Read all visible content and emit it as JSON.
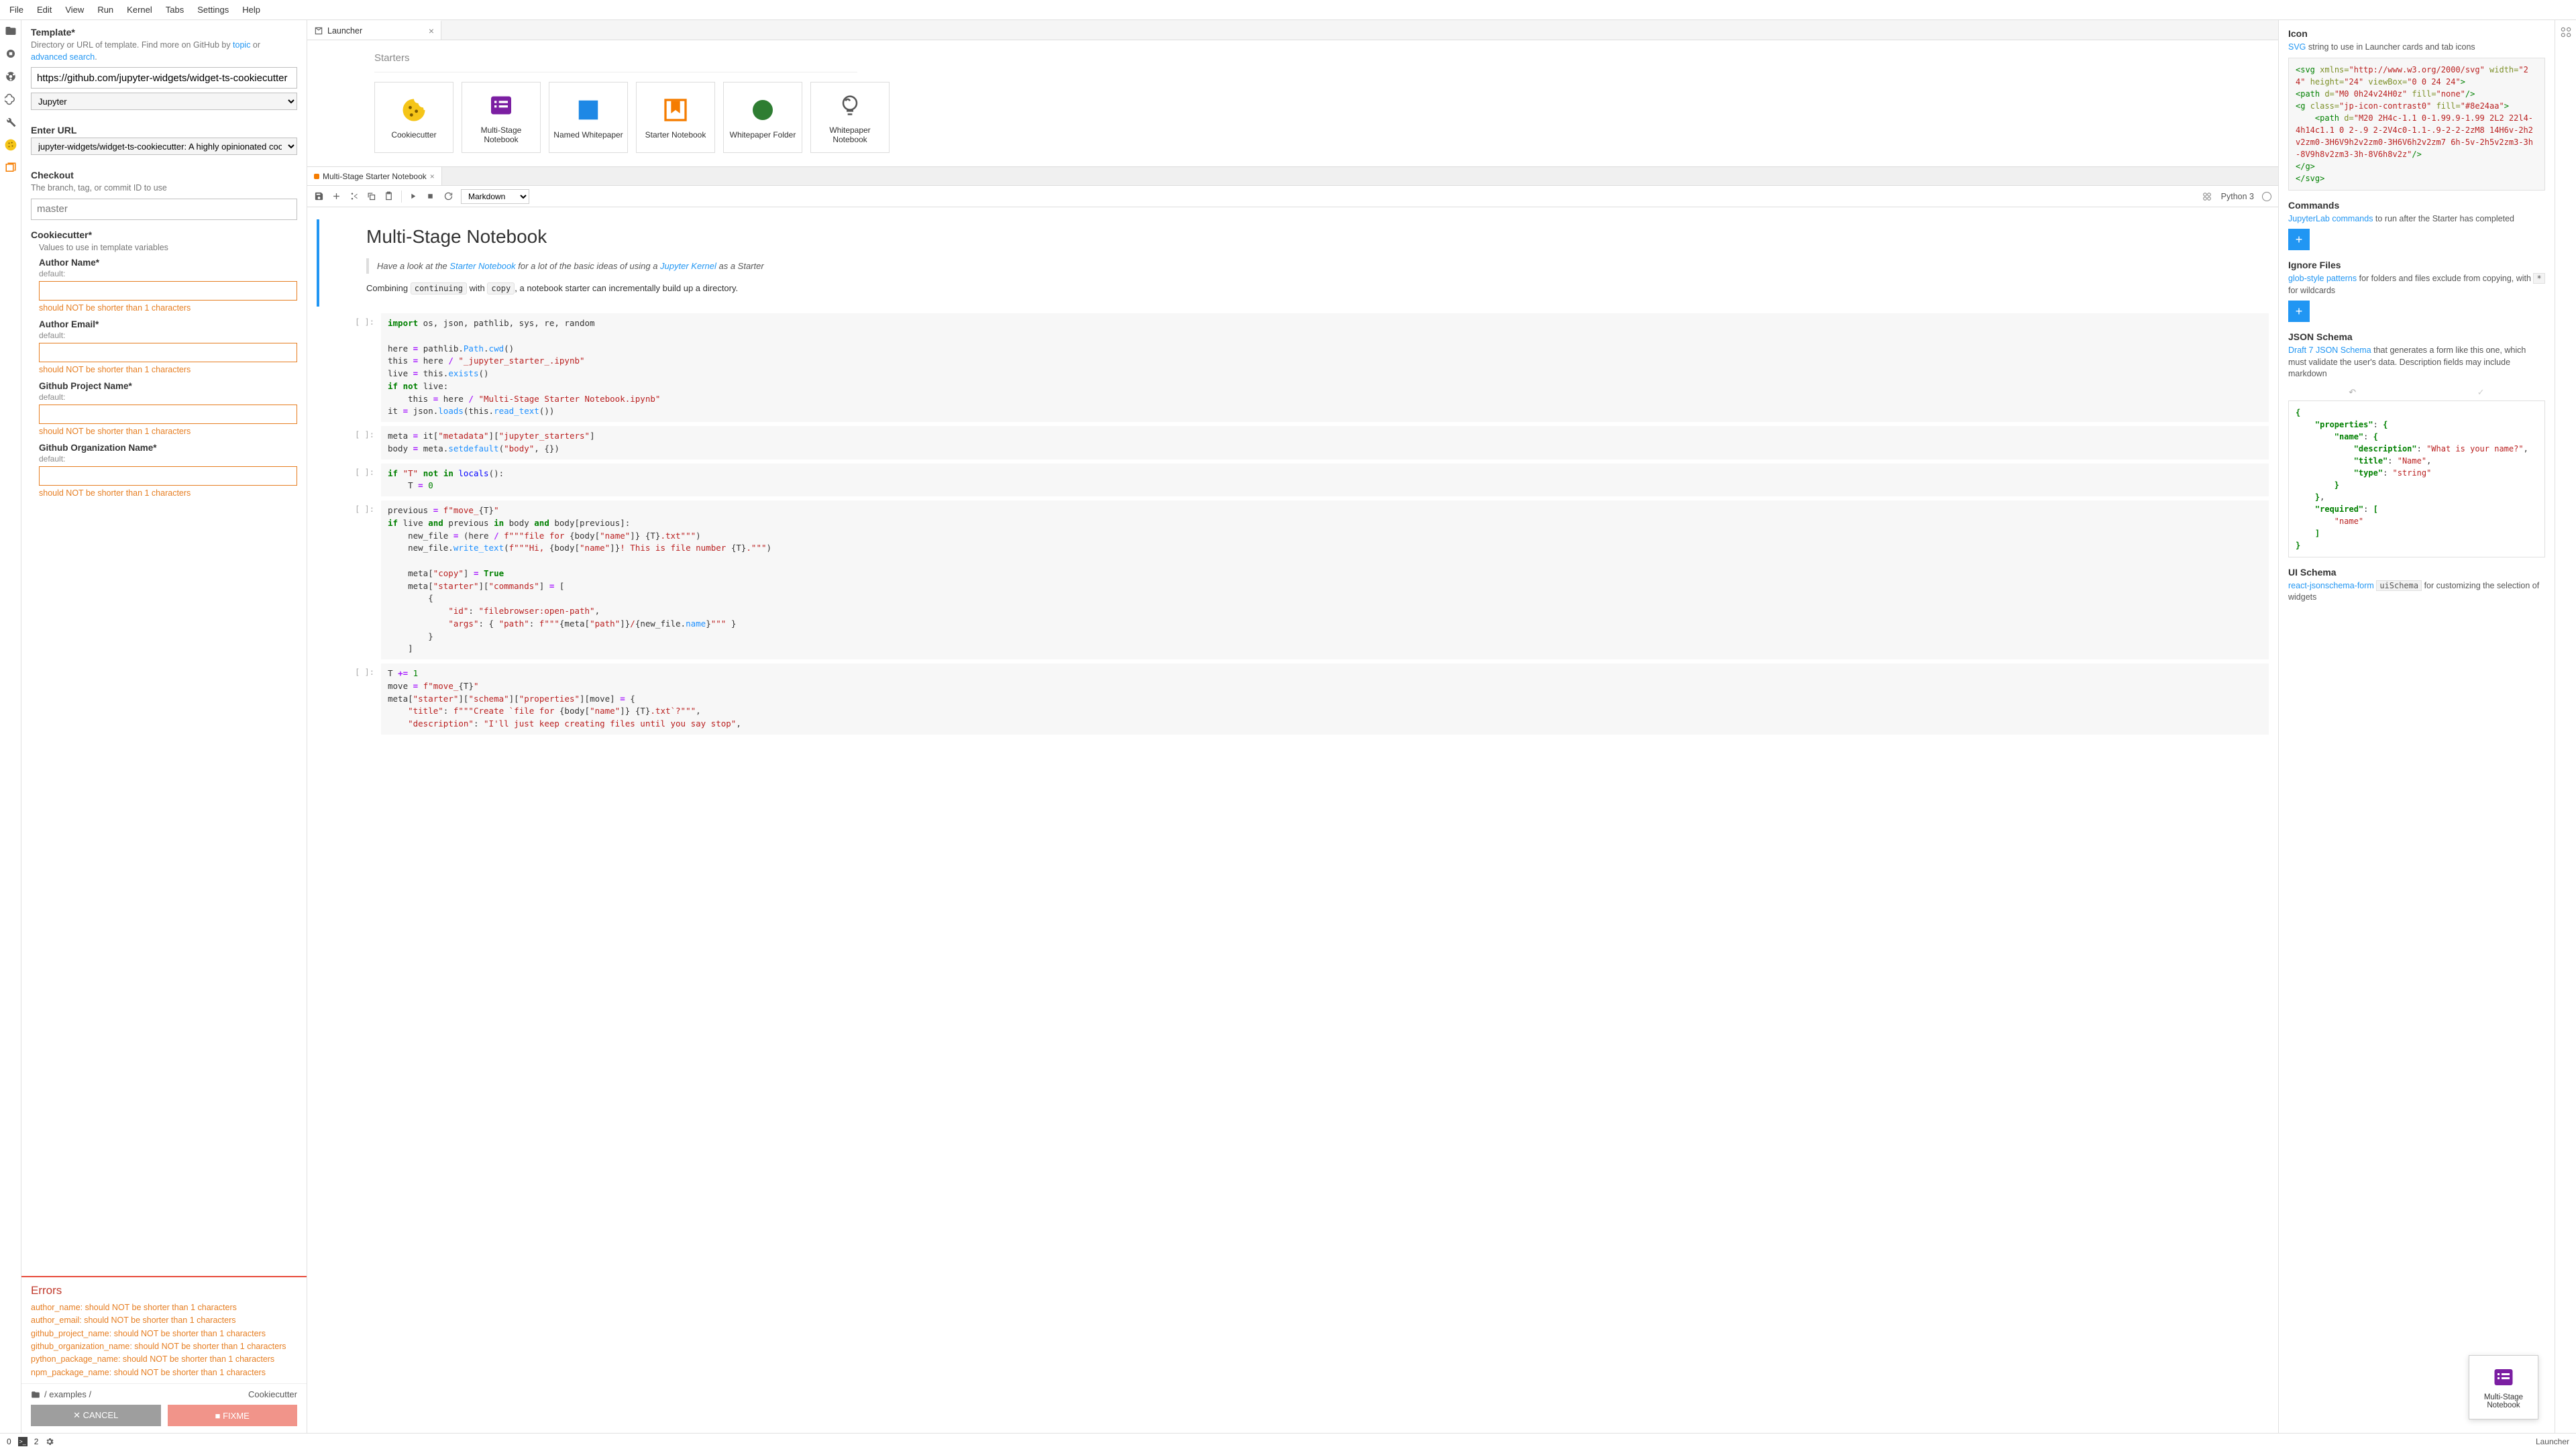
{
  "menu": [
    "File",
    "Edit",
    "View",
    "Run",
    "Kernel",
    "Tabs",
    "Settings",
    "Help"
  ],
  "left_panel": {
    "template_title": "Template*",
    "template_desc_prefix": "Directory or URL of template. Find more on GitHub by ",
    "template_link1": "topic",
    "template_desc_or": " or ",
    "template_link2": "advanced search",
    "template_value": "https://github.com/jupyter-widgets/widget-ts-cookiecutter",
    "template_select": "Jupyter",
    "enter_url_title": "Enter URL",
    "enter_url_value": "jupyter-widgets/widget-ts-cookiecutter: A highly opinionated cookiecutter template",
    "checkout_title": "Checkout",
    "checkout_desc": "The branch, tag, or commit ID to use",
    "checkout_placeholder": "master",
    "cookiecutter_title": "Cookiecutter*",
    "cookiecutter_desc": "Values to use in template variables",
    "fields": [
      {
        "label": "Author Name*",
        "sub": "default:",
        "error": "should NOT be shorter than 1 characters"
      },
      {
        "label": "Author Email*",
        "sub": "default:",
        "error": "should NOT be shorter than 1 characters"
      },
      {
        "label": "Github Project Name*",
        "sub": "default:",
        "error": "should NOT be shorter than 1 characters"
      },
      {
        "label": "Github Organization Name*",
        "sub": "default:",
        "error": "should NOT be shorter than 1 characters"
      }
    ],
    "errors_title": "Errors",
    "errors": [
      "author_name: should NOT be shorter than 1 characters",
      "author_email: should NOT be shorter than 1 characters",
      "github_project_name: should NOT be shorter than 1 characters",
      "github_organization_name: should NOT be shorter than 1 characters",
      "python_package_name: should NOT be shorter than 1 characters",
      "npm_package_name: should NOT be shorter than 1 characters"
    ],
    "breadcrumb": "/ examples /",
    "breadcrumb_right": "Cookiecutter",
    "cancel": "CANCEL",
    "fixme": "FIXME"
  },
  "launcher": {
    "tab": "Launcher",
    "heading": "Starters",
    "cards": [
      {
        "label": "Cookiecutter",
        "icon": "cookie"
      },
      {
        "label": "Multi-Stage Notebook",
        "icon": "list"
      },
      {
        "label": "Named Whitepaper",
        "icon": "square"
      },
      {
        "label": "Starter Notebook",
        "icon": "bookmark"
      },
      {
        "label": "Whitepaper Folder",
        "icon": "circle"
      },
      {
        "label": "Whitepaper Notebook",
        "icon": "bulb"
      }
    ]
  },
  "notebook": {
    "tab": "Multi-Stage Starter Notebook",
    "celltype": "Markdown",
    "kernel": "Python 3",
    "md": {
      "title": "Multi-Stage Notebook",
      "quote_pre": "Have a look at the ",
      "quote_link1": "Starter Notebook",
      "quote_mid": " for a lot of the basic ideas of using a ",
      "quote_link2": "Jupyter Kernel",
      "quote_post": " as a Starter",
      "para_pre": "Combining ",
      "para_c1": "continuing",
      "para_mid": " with ",
      "para_c2": "copy",
      "para_post": ", a notebook starter can incrementally build up a directory."
    },
    "prompt": "[ ]:"
  },
  "right": {
    "icon_title": "Icon",
    "icon_link": "SVG",
    "icon_desc": " string to use in Launcher cards and tab icons",
    "commands_title": "Commands",
    "commands_link": "JupyterLab commands",
    "commands_desc": " to run after the Starter has completed",
    "ignore_title": "Ignore Files",
    "ignore_link": "glob-style patterns",
    "ignore_desc1": " for folders and files exclude from copying, with ",
    "ignore_code": "*",
    "ignore_desc2": " for wildcards",
    "schema_title": "JSON Schema",
    "schema_link": "Draft 7 JSON Schema",
    "schema_desc": " that generates a form like this one, which must validate the user's data. Description fields may include markdown",
    "ui_title": "UI Schema",
    "ui_link": "react-jsonschema-form",
    "ui_code": "uiSchema",
    "ui_desc": " for customizing the selection of widgets",
    "float_label": "Multi-Stage Notebook"
  },
  "status": {
    "terms": "0",
    "n": "2",
    "right": "Launcher"
  }
}
